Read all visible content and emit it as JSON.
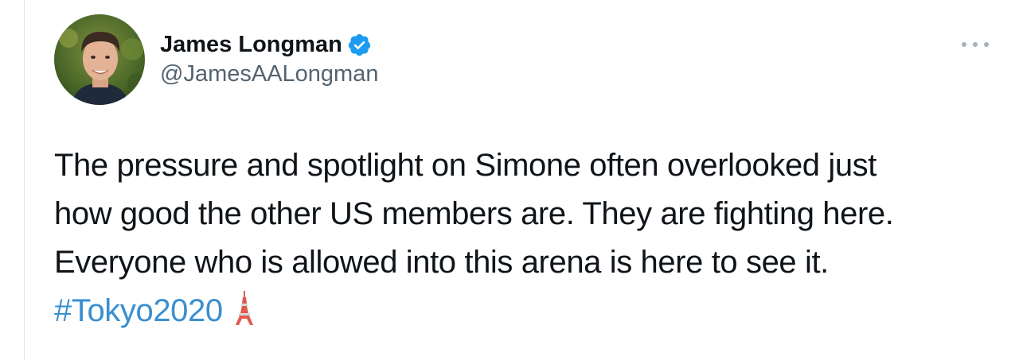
{
  "tweet": {
    "author": {
      "display_name": "James Longman",
      "handle": "@JamesAALongman",
      "verified": true,
      "avatar_icon": "profile-photo"
    },
    "more_icon": "more-options-icon",
    "text_lines": [
      "The pressure and spotlight on Simone often overlooked just",
      "how good the other US members are. They are fighting here.",
      "Everyone who is allowed into this arena is here to see it."
    ],
    "hashtag": "#Tokyo2020",
    "emoji_icon": "tokyo-tower-icon",
    "colors": {
      "text": "#0f1419",
      "secondary": "#536471",
      "link": "#3a8fd0",
      "verified": "#1d9bf0"
    }
  }
}
